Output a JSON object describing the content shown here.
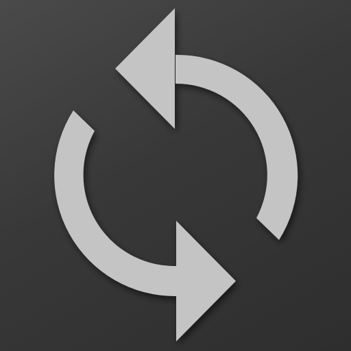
{
  "icon": {
    "name": "refresh-icon",
    "background_color": "#3a3a3a",
    "glyph_color": "#c4c4c4"
  }
}
